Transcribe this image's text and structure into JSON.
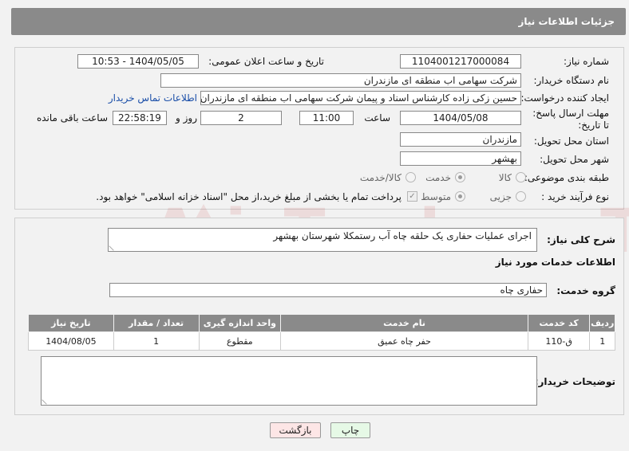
{
  "header": {
    "title": "جزئیات اطلاعات نیاز"
  },
  "need_number": {
    "label": "شماره نیاز:",
    "value": "1104001217000084"
  },
  "announce": {
    "label": "تاریخ و ساعت اعلان عمومی:",
    "value": "1404/05/05 - 10:53"
  },
  "buyer_org": {
    "label": "نام دستگاه خریدار:",
    "value": "شرکت سهامی اب منطقه ای مازندران"
  },
  "creator": {
    "label": "ایجاد کننده درخواست:",
    "value": "حسین زکی زاده کارشناس اسناد و پیمان شرکت سهامی اب منطقه ای مازندران",
    "contact_link": "اطلاعات تماس خریدار"
  },
  "deadline": {
    "label": "مهلت ارسال پاسخ: تا تاریخ:",
    "date": "1404/05/08",
    "time_label": "ساعت",
    "time": "11:00",
    "days": "2",
    "days_label": "روز و",
    "remaining": "22:58:19",
    "remaining_label": "ساعت باقی مانده"
  },
  "province": {
    "label": "استان محل تحویل:",
    "value": "مازندران"
  },
  "city": {
    "label": "شهر محل تحویل:",
    "value": "بهشهر"
  },
  "category": {
    "label": "طبقه بندی موضوعی:",
    "options": [
      "کالا",
      "خدمت",
      "کالا/خدمت"
    ],
    "selected": "خدمت"
  },
  "process": {
    "label": "نوع فرآیند خرید :",
    "options": [
      "جزیی",
      "متوسط"
    ],
    "selected": "متوسط",
    "payment_note": "پرداخت تمام یا بخشی از مبلغ خرید،از محل \"اسناد خزانه اسلامی\" خواهد بود."
  },
  "description": {
    "label": "شرح کلی نیاز:",
    "value": "اجرای عملیات حفاری یک حلقه چاه آب رستمکلا شهرستان بهشهر"
  },
  "services": {
    "section_title": "اطلاعات خدمات مورد نیاز",
    "group_label": "گروه خدمت:",
    "group_value": "حفاری چاه",
    "columns": [
      "ردیف",
      "کد خدمت",
      "نام خدمت",
      "واحد اندازه گیری",
      "تعداد / مقدار",
      "تاریخ نیاز"
    ],
    "rows": [
      {
        "row": "1",
        "code": "ق-110",
        "name": "حفر چاه عمیق",
        "unit": "مقطوع",
        "qty": "1",
        "date": "1404/08/05"
      }
    ]
  },
  "buyer_notes": {
    "label": "توضیحات خریدار:",
    "value": ""
  },
  "buttons": {
    "print": "چاپ",
    "back": "بازگشت"
  },
  "watermark": {
    "text": "AriaTender.neT"
  },
  "colors": {
    "header_bg": "#8a8a8a",
    "link": "#1a4ea8",
    "back_btn": "#fde6e6",
    "print_btn": "#e6f9e6",
    "watermark": "#c83c3c"
  }
}
